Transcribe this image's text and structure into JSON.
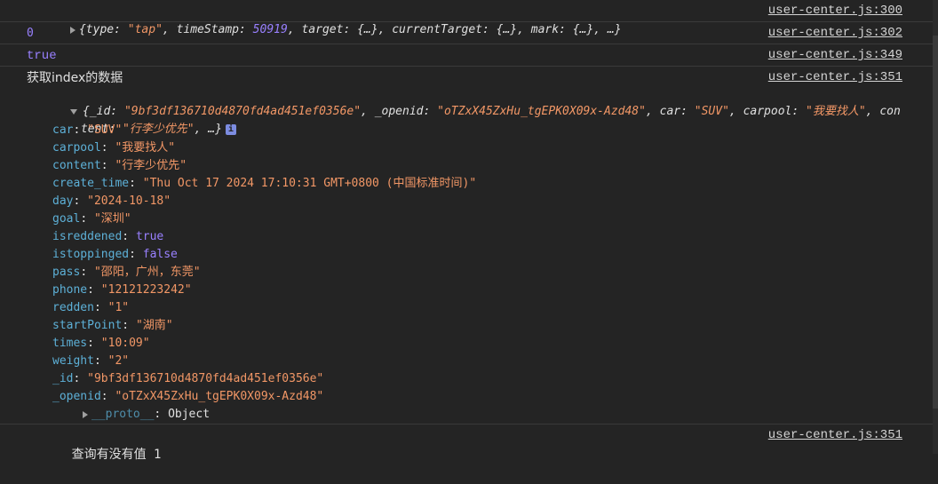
{
  "messages": {
    "event": {
      "open": "{",
      "type_key": "type",
      "type_val": "\"tap\"",
      "ts_key": "timeStamp",
      "ts_val": "50919",
      "target_key": "target",
      "target_val": "{…}",
      "ct_key": "currentTarget",
      "ct_val": "{…}",
      "mark_key": "mark",
      "mark_val": "{…}",
      "close": "…}",
      "source": "user-center.js:300"
    },
    "zero": {
      "value": "0",
      "source": "user-center.js:302"
    },
    "truth": {
      "value": "true",
      "source": "user-center.js:349"
    },
    "index_label": {
      "text": "获取index的数据",
      "source": "user-center.js:351"
    },
    "object": {
      "preview_line1_a": "{",
      "preview_id_key": "_id",
      "preview_id_val": "\"9bf3df136710d4870fd4ad451ef0356e\"",
      "preview_openid_key": "_openid",
      "preview_openid_val": "\"oTZxX45ZxHu_tgEPK0X09x-Azd48\"",
      "preview_car_key": "car",
      "preview_car_val": "\"SUV\"",
      "preview_carpool_key": "carpool",
      "preview_carpool_val": "\"我要找人\"",
      "preview_con": "con",
      "preview_line2_tent": "tent",
      "preview_content_val": "\"行李少优先\"",
      "preview_end": "…}",
      "info_icon": "i",
      "props": [
        {
          "key": "car",
          "value": "\"SUV\"",
          "kind": "str"
        },
        {
          "key": "carpool",
          "value": "\"我要找人\"",
          "kind": "str"
        },
        {
          "key": "content",
          "value": "\"行李少优先\"",
          "kind": "str"
        },
        {
          "key": "create_time",
          "value": "\"Thu Oct 17 2024 17:10:31 GMT+0800 (中国标准时间)\"",
          "kind": "str"
        },
        {
          "key": "day",
          "value": "\"2024-10-18\"",
          "kind": "str"
        },
        {
          "key": "goal",
          "value": "\"深圳\"",
          "kind": "str"
        },
        {
          "key": "isreddened",
          "value": "true",
          "kind": "bool"
        },
        {
          "key": "istoppinged",
          "value": "false",
          "kind": "bool"
        },
        {
          "key": "pass",
          "value": "\"邵阳，广州，东莞\"",
          "kind": "str"
        },
        {
          "key": "phone",
          "value": "\"12121223242\"",
          "kind": "str"
        },
        {
          "key": "redden",
          "value": "\"1\"",
          "kind": "str"
        },
        {
          "key": "startPoint",
          "value": "\"湖南\"",
          "kind": "str"
        },
        {
          "key": "times",
          "value": "\"10:09\"",
          "kind": "str"
        },
        {
          "key": "weight",
          "value": "\"2\"",
          "kind": "str"
        },
        {
          "key": "_id",
          "value": "\"9bf3df136710d4870fd4ad451ef0356e\"",
          "kind": "str"
        },
        {
          "key": "_openid",
          "value": "\"oTZxX45ZxHu_tgEPK0X09x-Azd48\"",
          "kind": "str"
        }
      ],
      "proto_key": "__proto__",
      "proto_val": "Object"
    },
    "query": {
      "text": "查询有没有值",
      "value": "1",
      "source": "user-center.js:351"
    }
  },
  "colors": {
    "background": "#242424",
    "string": "#f29766",
    "number": "#9980ff",
    "key": "#5db0d7",
    "separator": "#3a3a3a"
  }
}
